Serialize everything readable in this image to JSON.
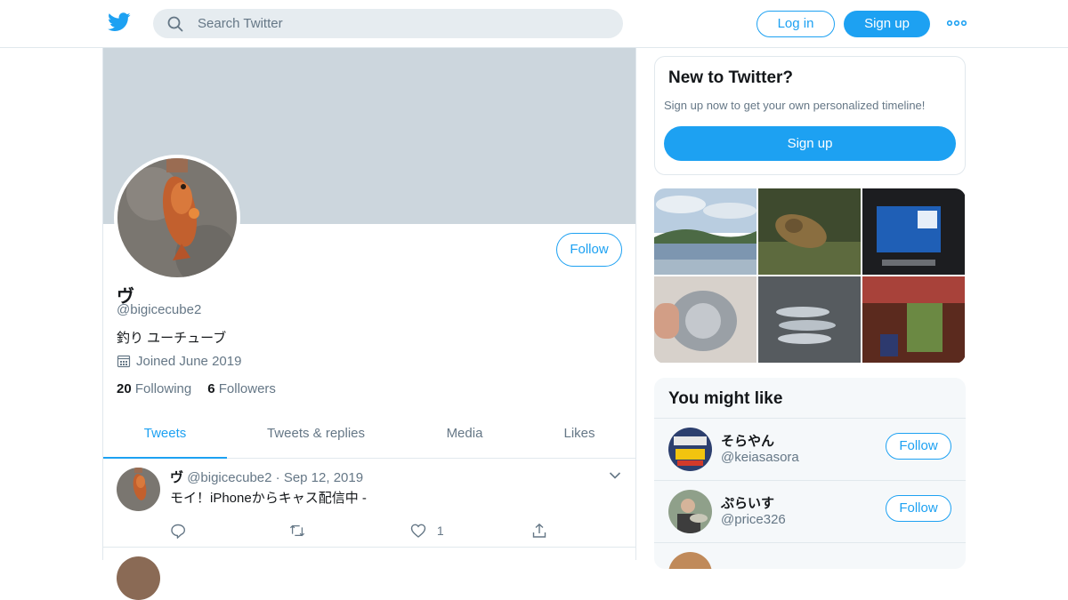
{
  "header": {
    "search_placeholder": "Search Twitter",
    "login_label": "Log in",
    "signup_label": "Sign up",
    "brand_color": "#1da1f2",
    "icons": [
      "twitter-bird-icon",
      "search-icon",
      "more-icon"
    ]
  },
  "profile": {
    "display_name": "ヴ",
    "handle": "@bigicecube2",
    "bio": "釣り ユーチューブ",
    "joined": "Joined June 2019",
    "following_count": "20",
    "following_label": "Following",
    "followers_count": "6",
    "followers_label": "Followers",
    "follow_label": "Follow"
  },
  "tabs": [
    {
      "label": "Tweets",
      "active": true
    },
    {
      "label": "Tweets & replies",
      "active": false
    },
    {
      "label": "Media",
      "active": false
    },
    {
      "label": "Likes",
      "active": false
    }
  ],
  "tweets": [
    {
      "name": "ヴ",
      "handle": "@bigicecube2",
      "separator": "·",
      "date": "Sep 12, 2019",
      "text": "モイ！iPhoneからキャス配信中 -",
      "like_count": "1"
    }
  ],
  "sidebar": {
    "new_title": "New to Twitter?",
    "new_text": "Sign up now to get your own personalized timeline!",
    "new_signup": "Sign up",
    "wtf_title": "You might like",
    "suggestions": [
      {
        "name": "そらやん",
        "handle": "@keiasasora",
        "follow": "Follow"
      },
      {
        "name": "ぷらいす",
        "handle": "@price326",
        "follow": "Follow"
      }
    ]
  }
}
